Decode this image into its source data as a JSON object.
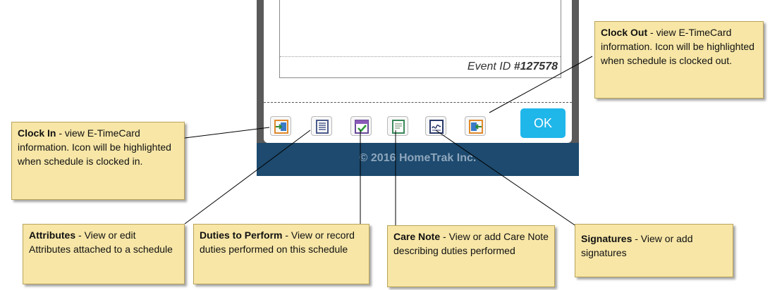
{
  "event": {
    "label": "Event ID ",
    "number": "#127578"
  },
  "ok_label": "OK",
  "footer_text": "© 2016 HomeTrak Inc.",
  "callouts": {
    "clock_in": {
      "title": "Clock In",
      "text": " - view E-TimeCard information. Icon will be highlighted when schedule is clocked in."
    },
    "clock_out": {
      "title": "Clock Out",
      "text": " - view E-TimeCard information. Icon will be highlighted when schedule is clocked out."
    },
    "attributes": {
      "title": "Attributes",
      "text": " - View or edit Attributes attached to a schedule"
    },
    "duties": {
      "title": "Duties to Perform",
      "text": " - View or record duties performed on this schedule"
    },
    "care_note": {
      "title": "Care Note",
      "text": " - View or add Care Note describing duties performed"
    },
    "signatures": {
      "title": "Signatures",
      "text": " - View or add signatures"
    }
  },
  "icons": [
    "clock-in-icon",
    "attributes-icon",
    "duties-icon",
    "care-note-icon",
    "signatures-icon",
    "clock-out-icon"
  ],
  "colors": {
    "ok_button": "#1fb6ea",
    "footer": "#1d4a6e",
    "callout_bg": "#f7e6a6",
    "frame": "#5a5a5a"
  }
}
